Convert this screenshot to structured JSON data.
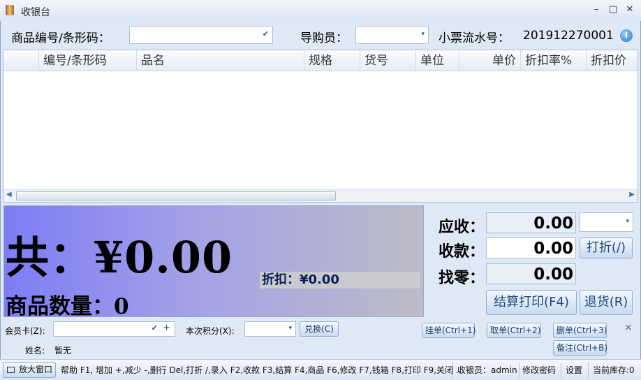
{
  "window": {
    "title": "收银台",
    "controls": [
      "–",
      "□",
      "✕"
    ]
  },
  "top": {
    "item_code_label": "商品编号/条形码：",
    "guide_label": "导购员：",
    "serial_label": "小票流水号：",
    "serial_value": "201912270001",
    "help_icon": "i"
  },
  "grid": {
    "columns": [
      "编号/条形码",
      "品名",
      "规格",
      "货号",
      "单位",
      "单价",
      "折扣率%",
      "折扣价"
    ]
  },
  "totals": {
    "total_text": "共：¥0.00",
    "qty_text": "商品数量：0",
    "discount_text": "折扣：¥0.00"
  },
  "pay": {
    "receivable_label": "应收：",
    "receivable_value": "0.00",
    "received_label": "收款：",
    "received_value": "0.00",
    "change_label": "找零：",
    "change_value": "0.00",
    "discount_button": "打折(/)",
    "checkout_button": "结算打印(F4)",
    "return_button": "退货(R)"
  },
  "member": {
    "card_label": "会员卡(Z):",
    "points_label": "本次积分(X):",
    "exchange_button": "兑换(C)",
    "name_label": "姓名:",
    "name_value": "暂无",
    "hold_button": "挂单(Ctrl+1)",
    "take_button": "取单(Ctrl+2)",
    "delete_button": "删单(Ctrl+3)",
    "note_button": "备注(Ctrl+B)",
    "close_x": "×"
  },
  "status": {
    "enlarge": "放大窗口",
    "help_text": "帮助 F1, 增加 +,减少 -,删行 Del,打折 /,录入 F2,收款 F3,结算 F4,商品 F6,修改 F7,钱箱 F8,打印 F9,关闭 ...",
    "cashier": "收银员：admin",
    "change_password": "修改密码",
    "settings": "设置",
    "stock": "当前库存:0"
  }
}
